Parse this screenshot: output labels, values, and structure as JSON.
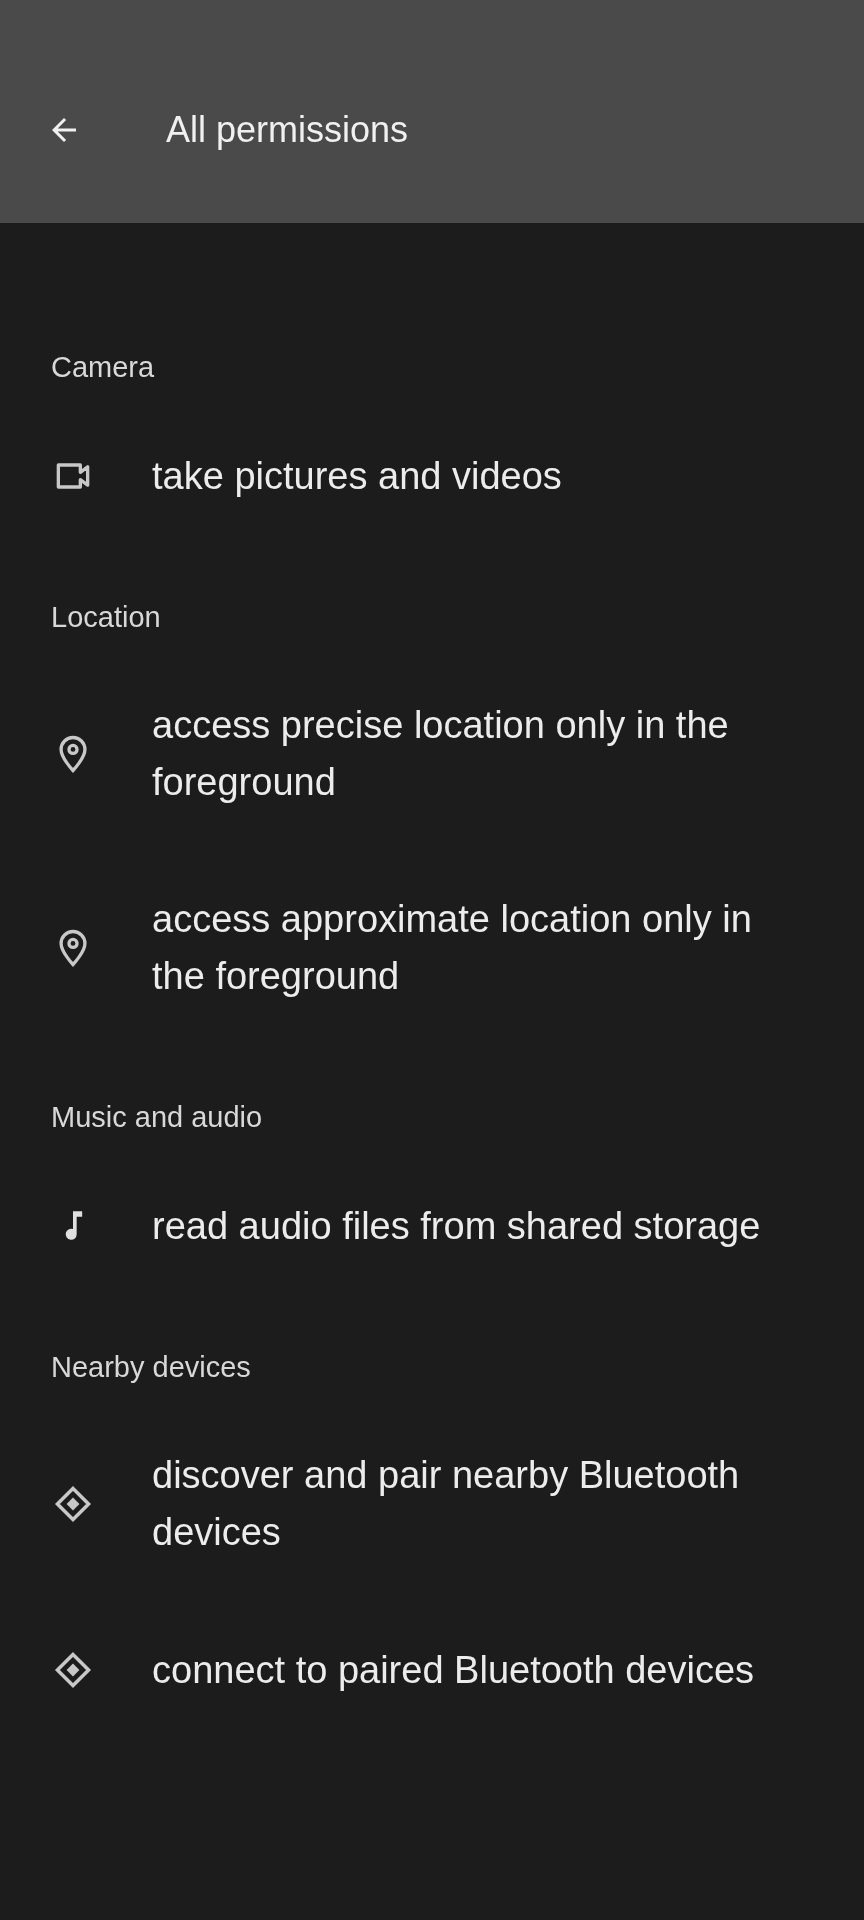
{
  "app_bar": {
    "title": "All permissions"
  },
  "groups": [
    {
      "title": "Camera",
      "items": [
        {
          "kind": "camera",
          "label": "take pictures and videos"
        }
      ]
    },
    {
      "title": "Location",
      "items": [
        {
          "kind": "location",
          "label": "access precise location only in the foreground"
        },
        {
          "kind": "location",
          "label": "access approximate location only in the foreground"
        }
      ]
    },
    {
      "title": "Music and audio",
      "items": [
        {
          "kind": "music",
          "label": "read audio files from shared storage"
        }
      ]
    },
    {
      "title": "Nearby devices",
      "items": [
        {
          "kind": "nearby",
          "label": "discover and pair nearby Bluetooth devices"
        },
        {
          "kind": "nearby",
          "label": "connect to paired Bluetooth devices"
        }
      ]
    }
  ]
}
